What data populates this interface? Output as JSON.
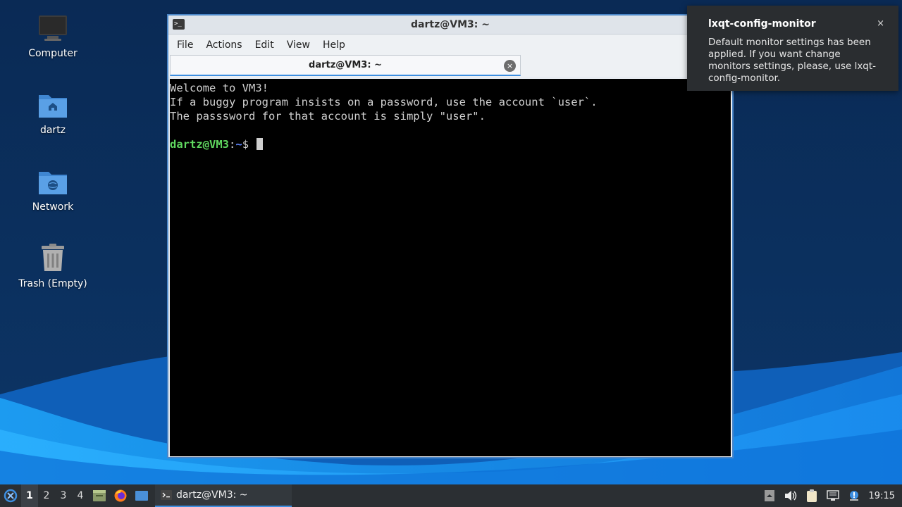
{
  "desktop": {
    "icons": [
      {
        "label": "Computer"
      },
      {
        "label": "dartz"
      },
      {
        "label": "Network"
      },
      {
        "label": "Trash (Empty)"
      }
    ]
  },
  "window": {
    "title": "dartz@VM3: ~",
    "menu": [
      "File",
      "Actions",
      "Edit",
      "View",
      "Help"
    ],
    "tab": {
      "label": "dartz@VM3: ~",
      "close_glyph": "×"
    }
  },
  "terminal": {
    "lines": [
      "Welcome to VM3!",
      "If a buggy program insists on a password, use the account `user`.",
      "The passsword for that account is simply \"user\"."
    ],
    "prompt_user": "dartz@VM3",
    "prompt_sep": ":",
    "prompt_path": "~",
    "prompt_symbol": "$"
  },
  "notification": {
    "title": "lxqt-config-monitor",
    "body": "Default monitor settings has been applied. If you want change monitors settings, please, use lxqt-config-monitor.",
    "close_glyph": "×"
  },
  "taskbar": {
    "workspaces": [
      "1",
      "2",
      "3",
      "4"
    ],
    "active_workspace": "1",
    "task_label": "dartz@VM3: ~",
    "clock": "19:15",
    "tray_icons": [
      "show-desktop-icon",
      "volume-icon",
      "clipboard-icon",
      "network-icon",
      "update-notifier-icon"
    ]
  },
  "colors": {
    "accent": "#3d8ee0",
    "terminal_bg": "#000000",
    "prompt_user": "#5fd75f",
    "prompt_path": "#5f87ff"
  }
}
